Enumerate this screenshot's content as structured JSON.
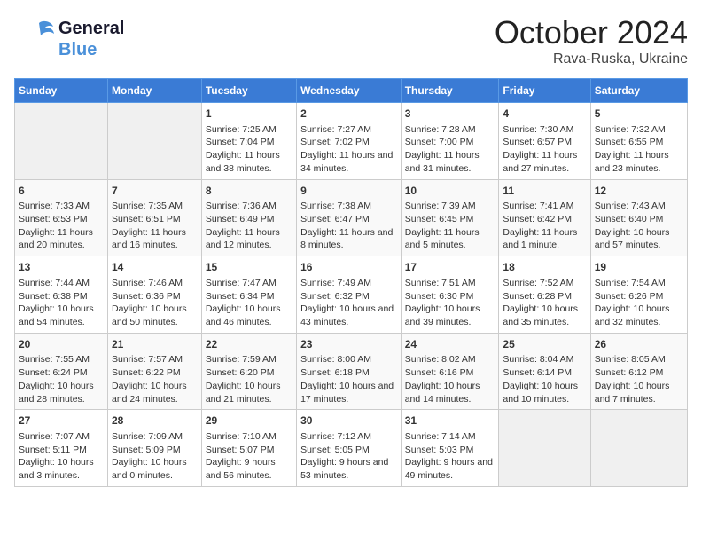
{
  "header": {
    "logo_line1": "General",
    "logo_line2": "Blue",
    "month": "October 2024",
    "location": "Rava-Ruska, Ukraine"
  },
  "weekdays": [
    "Sunday",
    "Monday",
    "Tuesday",
    "Wednesday",
    "Thursday",
    "Friday",
    "Saturday"
  ],
  "weeks": [
    [
      {
        "day": "",
        "content": ""
      },
      {
        "day": "",
        "content": ""
      },
      {
        "day": "1",
        "content": "Sunrise: 7:25 AM\nSunset: 7:04 PM\nDaylight: 11 hours and 38 minutes."
      },
      {
        "day": "2",
        "content": "Sunrise: 7:27 AM\nSunset: 7:02 PM\nDaylight: 11 hours and 34 minutes."
      },
      {
        "day": "3",
        "content": "Sunrise: 7:28 AM\nSunset: 7:00 PM\nDaylight: 11 hours and 31 minutes."
      },
      {
        "day": "4",
        "content": "Sunrise: 7:30 AM\nSunset: 6:57 PM\nDaylight: 11 hours and 27 minutes."
      },
      {
        "day": "5",
        "content": "Sunrise: 7:32 AM\nSunset: 6:55 PM\nDaylight: 11 hours and 23 minutes."
      }
    ],
    [
      {
        "day": "6",
        "content": "Sunrise: 7:33 AM\nSunset: 6:53 PM\nDaylight: 11 hours and 20 minutes."
      },
      {
        "day": "7",
        "content": "Sunrise: 7:35 AM\nSunset: 6:51 PM\nDaylight: 11 hours and 16 minutes."
      },
      {
        "day": "8",
        "content": "Sunrise: 7:36 AM\nSunset: 6:49 PM\nDaylight: 11 hours and 12 minutes."
      },
      {
        "day": "9",
        "content": "Sunrise: 7:38 AM\nSunset: 6:47 PM\nDaylight: 11 hours and 8 minutes."
      },
      {
        "day": "10",
        "content": "Sunrise: 7:39 AM\nSunset: 6:45 PM\nDaylight: 11 hours and 5 minutes."
      },
      {
        "day": "11",
        "content": "Sunrise: 7:41 AM\nSunset: 6:42 PM\nDaylight: 11 hours and 1 minute."
      },
      {
        "day": "12",
        "content": "Sunrise: 7:43 AM\nSunset: 6:40 PM\nDaylight: 10 hours and 57 minutes."
      }
    ],
    [
      {
        "day": "13",
        "content": "Sunrise: 7:44 AM\nSunset: 6:38 PM\nDaylight: 10 hours and 54 minutes."
      },
      {
        "day": "14",
        "content": "Sunrise: 7:46 AM\nSunset: 6:36 PM\nDaylight: 10 hours and 50 minutes."
      },
      {
        "day": "15",
        "content": "Sunrise: 7:47 AM\nSunset: 6:34 PM\nDaylight: 10 hours and 46 minutes."
      },
      {
        "day": "16",
        "content": "Sunrise: 7:49 AM\nSunset: 6:32 PM\nDaylight: 10 hours and 43 minutes."
      },
      {
        "day": "17",
        "content": "Sunrise: 7:51 AM\nSunset: 6:30 PM\nDaylight: 10 hours and 39 minutes."
      },
      {
        "day": "18",
        "content": "Sunrise: 7:52 AM\nSunset: 6:28 PM\nDaylight: 10 hours and 35 minutes."
      },
      {
        "day": "19",
        "content": "Sunrise: 7:54 AM\nSunset: 6:26 PM\nDaylight: 10 hours and 32 minutes."
      }
    ],
    [
      {
        "day": "20",
        "content": "Sunrise: 7:55 AM\nSunset: 6:24 PM\nDaylight: 10 hours and 28 minutes."
      },
      {
        "day": "21",
        "content": "Sunrise: 7:57 AM\nSunset: 6:22 PM\nDaylight: 10 hours and 24 minutes."
      },
      {
        "day": "22",
        "content": "Sunrise: 7:59 AM\nSunset: 6:20 PM\nDaylight: 10 hours and 21 minutes."
      },
      {
        "day": "23",
        "content": "Sunrise: 8:00 AM\nSunset: 6:18 PM\nDaylight: 10 hours and 17 minutes."
      },
      {
        "day": "24",
        "content": "Sunrise: 8:02 AM\nSunset: 6:16 PM\nDaylight: 10 hours and 14 minutes."
      },
      {
        "day": "25",
        "content": "Sunrise: 8:04 AM\nSunset: 6:14 PM\nDaylight: 10 hours and 10 minutes."
      },
      {
        "day": "26",
        "content": "Sunrise: 8:05 AM\nSunset: 6:12 PM\nDaylight: 10 hours and 7 minutes."
      }
    ],
    [
      {
        "day": "27",
        "content": "Sunrise: 7:07 AM\nSunset: 5:11 PM\nDaylight: 10 hours and 3 minutes."
      },
      {
        "day": "28",
        "content": "Sunrise: 7:09 AM\nSunset: 5:09 PM\nDaylight: 10 hours and 0 minutes."
      },
      {
        "day": "29",
        "content": "Sunrise: 7:10 AM\nSunset: 5:07 PM\nDaylight: 9 hours and 56 minutes."
      },
      {
        "day": "30",
        "content": "Sunrise: 7:12 AM\nSunset: 5:05 PM\nDaylight: 9 hours and 53 minutes."
      },
      {
        "day": "31",
        "content": "Sunrise: 7:14 AM\nSunset: 5:03 PM\nDaylight: 9 hours and 49 minutes."
      },
      {
        "day": "",
        "content": ""
      },
      {
        "day": "",
        "content": ""
      }
    ]
  ]
}
